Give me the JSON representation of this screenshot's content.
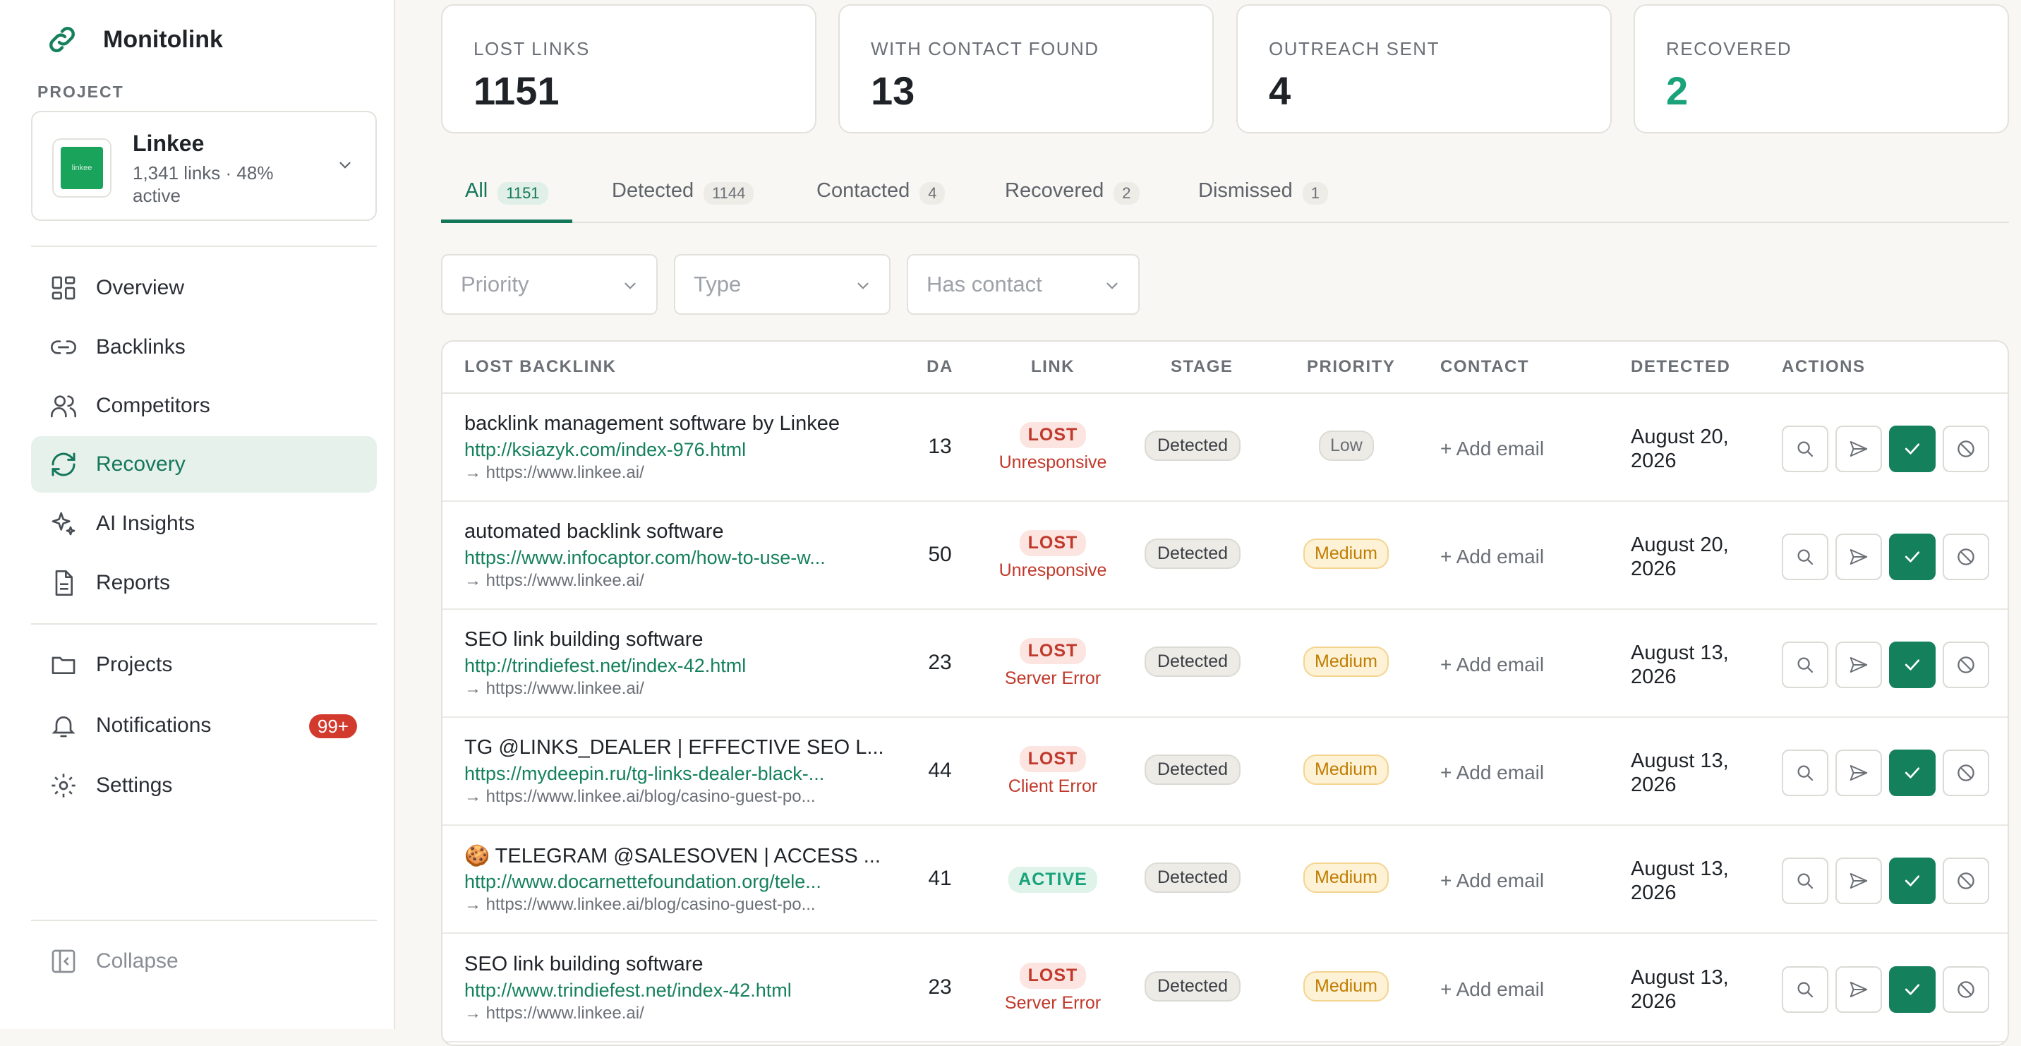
{
  "app": {
    "name": "Monitolink"
  },
  "project": {
    "section_label": "PROJECT",
    "name": "Linkee",
    "meta": "1,341 links · 48% active",
    "logo_text": "linkee"
  },
  "nav": {
    "items": [
      {
        "label": "Overview",
        "icon": "grid-icon"
      },
      {
        "label": "Backlinks",
        "icon": "link-icon"
      },
      {
        "label": "Competitors",
        "icon": "users-icon"
      },
      {
        "label": "Recovery",
        "icon": "refresh-icon",
        "active": true
      },
      {
        "label": "AI Insights",
        "icon": "sparkle-icon"
      },
      {
        "label": "Reports",
        "icon": "document-icon"
      }
    ],
    "items2": [
      {
        "label": "Projects",
        "icon": "folder-icon"
      },
      {
        "label": "Notifications",
        "icon": "bell-icon",
        "badge": "99+"
      },
      {
        "label": "Settings",
        "icon": "gear-icon"
      }
    ],
    "collapse": "Collapse"
  },
  "stats": [
    {
      "title": "LOST LINKS",
      "value": "1151"
    },
    {
      "title": "WITH CONTACT FOUND",
      "value": "13"
    },
    {
      "title": "OUTREACH SENT",
      "value": "4"
    },
    {
      "title": "RECOVERED",
      "value": "2"
    }
  ],
  "tabs": [
    {
      "label": "All",
      "count": "1151",
      "active": true
    },
    {
      "label": "Detected",
      "count": "1144"
    },
    {
      "label": "Contacted",
      "count": "4"
    },
    {
      "label": "Recovered",
      "count": "2"
    },
    {
      "label": "Dismissed",
      "count": "1"
    }
  ],
  "filters": [
    {
      "placeholder": "Priority"
    },
    {
      "placeholder": "Type"
    },
    {
      "placeholder": "Has contact"
    }
  ],
  "table": {
    "headers": [
      "LOST BACKLINK",
      "DA",
      "LINK",
      "STAGE",
      "PRIORITY",
      "CONTACT",
      "DETECTED",
      "ACTIONS"
    ],
    "rows": [
      {
        "title": "backlink management software by Linkee",
        "url": "http://ksiazyk.com/index-976.html",
        "target": "→ https://www.linkee.ai/",
        "da": "13",
        "status": "LOST",
        "reason": "Unresponsive",
        "stage": "Detected",
        "priority": "Low",
        "contact": "+ Add email",
        "detected": "August 20, 2026"
      },
      {
        "title": "automated backlink software",
        "url": "https://www.infocaptor.com/how-to-use-w...",
        "target": "→ https://www.linkee.ai/",
        "da": "50",
        "status": "LOST",
        "reason": "Unresponsive",
        "stage": "Detected",
        "priority": "Medium",
        "contact": "+ Add email",
        "detected": "August 20, 2026"
      },
      {
        "title": "SEO link building software",
        "url": "http://trindiefest.net/index-42.html",
        "target": "→ https://www.linkee.ai/",
        "da": "23",
        "status": "LOST",
        "reason": "Server Error",
        "stage": "Detected",
        "priority": "Medium",
        "contact": "+ Add email",
        "detected": "August 13, 2026"
      },
      {
        "title": "TG @LINKS_DEALER | EFFECTIVE SEO L...",
        "url": "https://mydeepin.ru/tg-links-dealer-black-...",
        "target": "→ https://www.linkee.ai/blog/casino-guest-po...",
        "da": "44",
        "status": "LOST",
        "reason": "Client Error",
        "stage": "Detected",
        "priority": "Medium",
        "contact": "+ Add email",
        "detected": "August 13, 2026"
      },
      {
        "title": "🍪 TELEGRAM @SALESOVEN | ACCESS ...",
        "url": "http://www.docarnettefoundation.org/tele...",
        "target": "→ https://www.linkee.ai/blog/casino-guest-po...",
        "da": "41",
        "status": "ACTIVE",
        "reason": "",
        "stage": "Detected",
        "priority": "Medium",
        "contact": "+ Add email",
        "detected": "August 13, 2026"
      },
      {
        "title": "SEO link building software",
        "url": "http://www.trindiefest.net/index-42.html",
        "target": "→ https://www.linkee.ai/",
        "da": "23",
        "status": "LOST",
        "reason": "Server Error",
        "stage": "Detected",
        "priority": "Medium",
        "contact": "+ Add email",
        "detected": "August 13, 2026"
      }
    ]
  }
}
